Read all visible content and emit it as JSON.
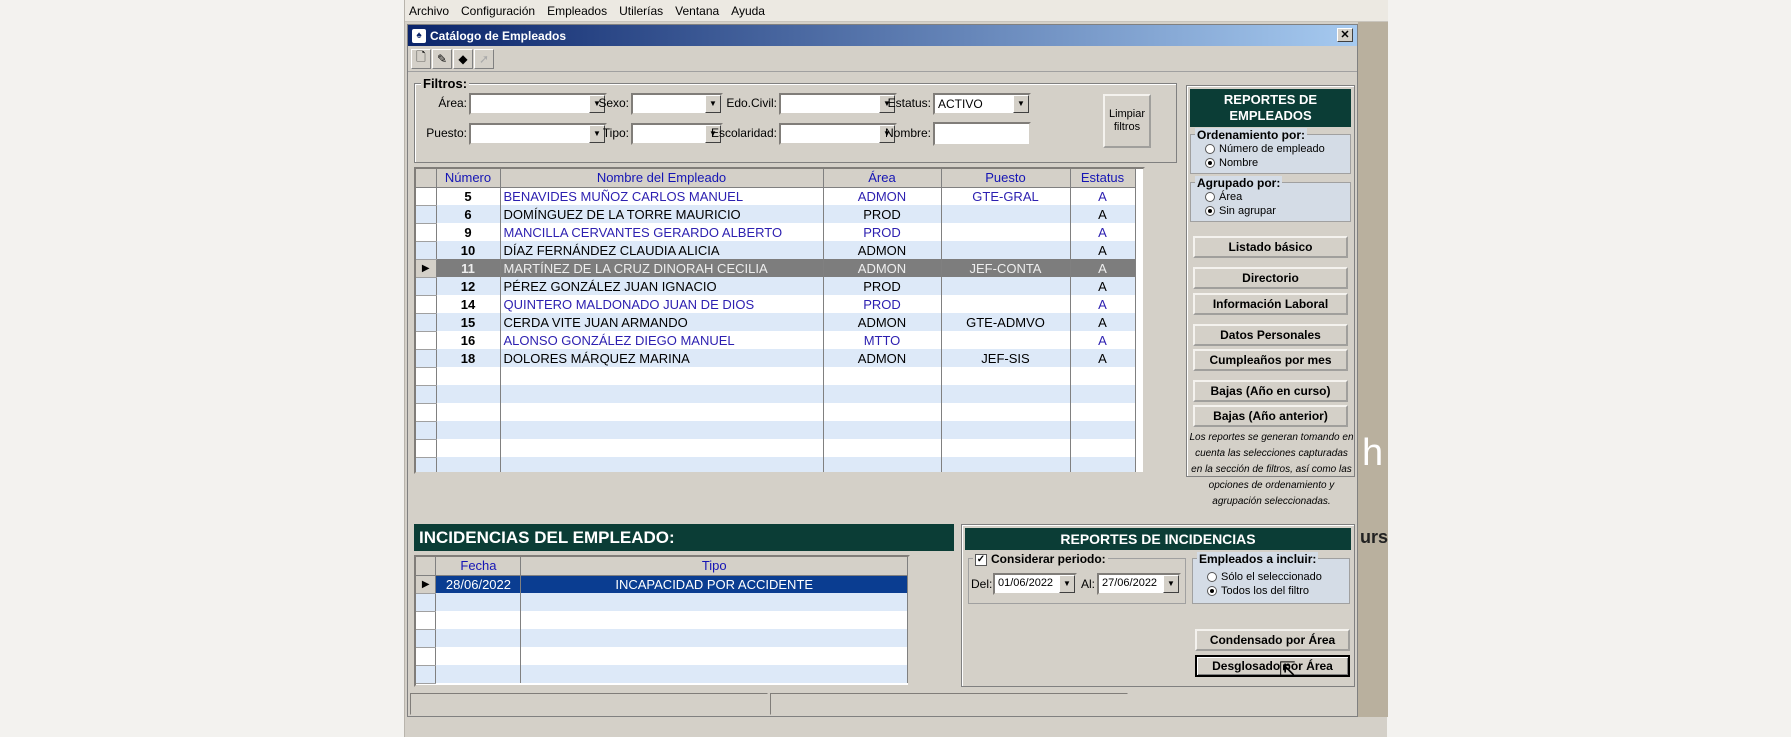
{
  "menu": [
    "Archivo",
    "Configuración",
    "Empleados",
    "Utilerías",
    "Ventana",
    "Ayuda"
  ],
  "window": {
    "title": "Catálogo de Empleados",
    "close": "✕"
  },
  "toolbar": {
    "new_icon": "new-document-icon",
    "edit_icon": "edit-icon",
    "diamond_icon": "diamond-icon",
    "pointer_icon": "pointer-icon"
  },
  "filters": {
    "title": "Filtros:",
    "area_label": "Área:",
    "sexo_label": "Sexo:",
    "edocivil_label": "Edo.Civil:",
    "estatus_label": "Estatus:",
    "estatus_value": "ACTIVO",
    "puesto_label": "Puesto:",
    "tipo_label": "Tipo:",
    "escolaridad_label": "Escolaridad:",
    "nombre_label": "Nombre:",
    "clear_button": "Limpiar filtros"
  },
  "employees": {
    "headers": [
      "Número",
      "Nombre del Empleado",
      "Área",
      "Puesto",
      "Estatus"
    ],
    "rows": [
      {
        "num": "5",
        "name": "BENAVIDES MUÑOZ CARLOS MANUEL",
        "area": "ADMON",
        "puesto": "GTE-GRAL",
        "estatus": "A"
      },
      {
        "num": "6",
        "name": "DOMÍNGUEZ DE LA TORRE MAURICIO",
        "area": "PROD",
        "puesto": "",
        "estatus": "A"
      },
      {
        "num": "9",
        "name": "MANCILLA CERVANTES GERARDO ALBERTO",
        "area": "PROD",
        "puesto": "",
        "estatus": "A"
      },
      {
        "num": "10",
        "name": "DÍAZ FERNÁNDEZ CLAUDIA ALICIA",
        "area": "ADMON",
        "puesto": "",
        "estatus": "A"
      },
      {
        "num": "11",
        "name": "MARTÍNEZ DE LA CRUZ DINORAH CECILIA",
        "area": "ADMON",
        "puesto": "JEF-CONTA",
        "estatus": "A"
      },
      {
        "num": "12",
        "name": "PÉREZ GONZÁLEZ JUAN IGNACIO",
        "area": "PROD",
        "puesto": "",
        "estatus": "A"
      },
      {
        "num": "14",
        "name": "QUINTERO MALDONADO JUAN DE DIOS",
        "area": "PROD",
        "puesto": "",
        "estatus": "A"
      },
      {
        "num": "15",
        "name": "CERDA VITE JUAN ARMANDO",
        "area": "ADMON",
        "puesto": "GTE-ADMVO",
        "estatus": "A"
      },
      {
        "num": "16",
        "name": "ALONSO GONZÁLEZ DIEGO MANUEL",
        "area": "MTTO",
        "puesto": "",
        "estatus": "A"
      },
      {
        "num": "18",
        "name": "DOLORES MÁRQUEZ MARINA",
        "area": "ADMON",
        "puesto": "JEF-SIS",
        "estatus": "A"
      }
    ]
  },
  "reports": {
    "title": "REPORTES DE EMPLEADOS",
    "order_label": "Ordenamiento por:",
    "order_opt1": "Número de empleado",
    "order_opt2": "Nombre",
    "group_label": "Agrupado por:",
    "group_opt1": "Área",
    "group_opt2": "Sin agrupar",
    "buttons": [
      "Listado básico",
      "Directorio",
      "Información Laboral",
      "Datos Personales",
      "Cumpleaños por mes",
      "Bajas (Año en curso)",
      "Bajas (Año anterior)"
    ],
    "note": "Los reportes se generan tomando en cuenta las selecciones capturadas en la sección de filtros, así como las opciones de ordenamiento y agrupación seleccionadas."
  },
  "incidents": {
    "title": "INCIDENCIAS DEL EMPLEADO:",
    "headers": [
      "Fecha",
      "Tipo"
    ],
    "rows": [
      {
        "fecha": "28/06/2022",
        "tipo": "INCAPACIDAD POR ACCIDENTE"
      }
    ]
  },
  "incident_reports": {
    "title": "REPORTES DE INCIDENCIAS",
    "period_label": "Considerar periodo:",
    "check": "✓",
    "del_label": "Del:",
    "del_value": "01/06/2022",
    "al_label": "Al:",
    "al_value": "27/06/2022",
    "include_label": "Empleados a incluir:",
    "include_opt1": "Sólo el seleccionado",
    "include_opt2": "Todos los del filtro",
    "btn_condensed": "Condensado por Área",
    "btn_detailed": "Desglosado por Área"
  },
  "background": {
    "ghost_char": "h",
    "ghost_text": "urs"
  }
}
